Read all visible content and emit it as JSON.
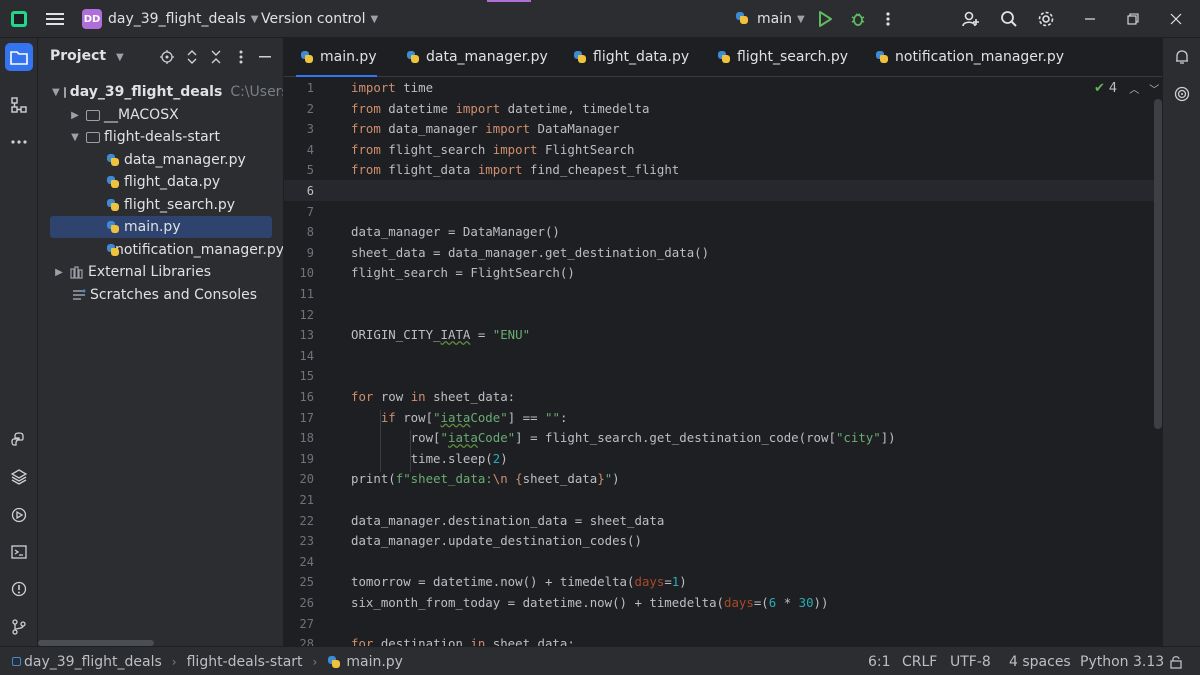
{
  "titlebar": {
    "project_badge": "DD",
    "project_name": "day_39_flight_deals",
    "vcs_label": "Version control",
    "run_config": "main"
  },
  "project_panel": {
    "title": "Project",
    "tree": [
      {
        "label": "day_39_flight_deals",
        "hint": "C:\\Users\\",
        "type": "folder",
        "expanded": true
      },
      {
        "label": "__MACOSX",
        "type": "folder",
        "expanded": false
      },
      {
        "label": "flight-deals-start",
        "type": "folder",
        "expanded": true
      },
      {
        "label": "data_manager.py",
        "type": "python"
      },
      {
        "label": "flight_data.py",
        "type": "python"
      },
      {
        "label": "flight_search.py",
        "type": "python"
      },
      {
        "label": "main.py",
        "type": "python",
        "selected": true
      },
      {
        "label": "notification_manager.py",
        "type": "python"
      },
      {
        "label": "External Libraries",
        "type": "library"
      },
      {
        "label": "Scratches and Consoles",
        "type": "scratches"
      }
    ]
  },
  "tabs": [
    {
      "label": "main.py",
      "active": true
    },
    {
      "label": "data_manager.py"
    },
    {
      "label": "flight_data.py"
    },
    {
      "label": "flight_search.py"
    },
    {
      "label": "notification_manager.py"
    }
  ],
  "editor": {
    "inspection_count": "4",
    "line_numbers": [
      "1",
      "2",
      "3",
      "4",
      "5",
      "6",
      "7",
      "8",
      "9",
      "10",
      "11",
      "12",
      "13",
      "14",
      "15",
      "16",
      "17",
      "18",
      "19",
      "20",
      "21",
      "22",
      "23",
      "24",
      "25",
      "26",
      "27",
      "28"
    ],
    "caret_line": 6
  },
  "statusbar": {
    "breadcrumb": [
      "day_39_flight_deals",
      "flight-deals-start",
      "main.py"
    ],
    "position": "6:1",
    "line_ending": "CRLF",
    "encoding": "UTF-8",
    "indent": "4 spaces",
    "interpreter": "Python 3.13"
  },
  "colors": {
    "accent": "#3574f0",
    "project_badge": "#b06fd8",
    "keyword": "#cf8e6d",
    "string": "#6aab73",
    "number": "#2aacb8",
    "param": "#aa4926",
    "run_green": "#5fb85f"
  }
}
